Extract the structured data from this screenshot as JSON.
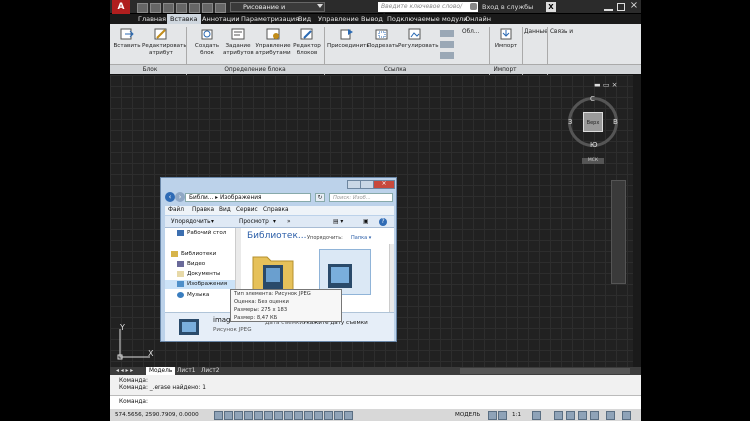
{
  "titlebar": {
    "workspace": "Рисование и аннотации",
    "search_placeholder": "Введите ключевое слово/фразу",
    "signin": "Вход в службы"
  },
  "menu": [
    "Главная",
    "Вставка",
    "Аннотации",
    "Параметризация",
    "Вид",
    "Управление",
    "Вывод",
    "Подключаемые модули",
    "Онлайн"
  ],
  "ribbon": {
    "buttons": [
      "Вставить",
      "Редактировать атрибут",
      "Создать блок",
      "Задание атрибутов",
      "Управление атрибутами",
      "Редактор блоков",
      "Присоединить",
      "Подрезать",
      "Регулировать",
      "Импорт",
      "Данные",
      "Связь и"
    ],
    "panels": [
      "Блок",
      "Определение блока",
      "Ссылка",
      "Импорт"
    ],
    "overflow": "Обл..."
  },
  "viewcube": {
    "north": "С",
    "south": "Ю",
    "west": "З",
    "east": "В",
    "face": "Верх",
    "wcs": "МСК"
  },
  "explorer": {
    "address_root": "Библи...",
    "address_leaf": "Изображения",
    "search_placeholder": "Поиск: Изоб...",
    "menu": [
      "Файл",
      "Правка",
      "Вид",
      "Сервис",
      "Справка"
    ],
    "toolbar": [
      "Упорядочить",
      "Просмотр"
    ],
    "nav": [
      "Рабочий стол",
      "Библиотеки",
      "Видео",
      "Документы",
      "Изображения",
      "Музыка"
    ],
    "library_title": "Библиотек...",
    "arrange_label": "Упорядочить:",
    "arrange_value": "Папка",
    "details": {
      "name": "images",
      "type": "Рисунок JPEG",
      "date_label": "Дата съемки:",
      "date_value": "Укажите дату съемки"
    }
  },
  "tooltip": [
    "Тип элемента: Рисунок JPEG",
    "Оценка: Без оценки",
    "Размеры: 275 x 183",
    "Размер: 8,47 КБ"
  ],
  "ucs": {
    "x": "X",
    "y": "Y"
  },
  "tabs": [
    "Модель",
    "Лист1",
    "Лист2"
  ],
  "command": {
    "line1": "Команда:",
    "line2": "Команда: _.erase найдено: 1",
    "prompt": "Команда:"
  },
  "status": {
    "coords": "574.5656, 2590.7909, 0.0000",
    "model": "МОДЕЛЬ",
    "scale": "1:1"
  }
}
